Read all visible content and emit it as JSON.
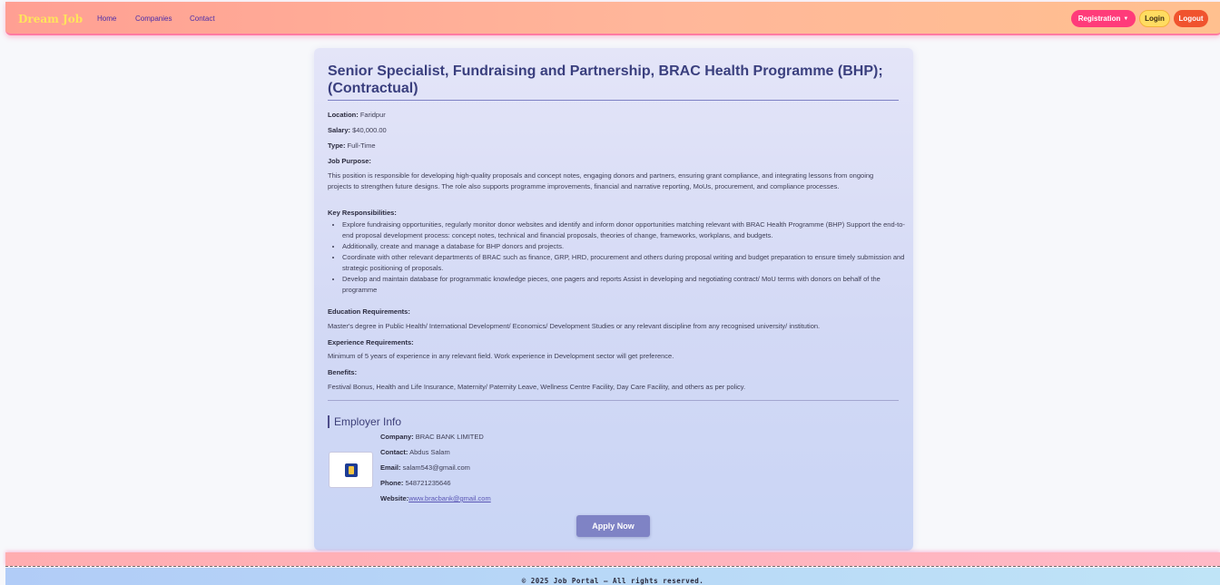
{
  "navbar": {
    "brand": "Dream Job",
    "links": [
      "Home",
      "Companies",
      "Contact"
    ],
    "registration_label": "Registration",
    "login_label": "Login",
    "logout_label": "Logout"
  },
  "job": {
    "title": "Senior Specialist, Fundraising and Partnership, BRAC Health Programme (BHP); (Contractual)",
    "location_label": "Location:",
    "location": "Faridpur",
    "salary_label": "Salary:",
    "salary": "$40,000.00",
    "type_label": "Type:",
    "type": "Full-Time",
    "purpose_label": "Job Purpose:",
    "purpose": "This position is responsible for developing high-quality proposals and concept notes, engaging donors and partners, ensuring grant compliance, and integrating lessons from ongoing projects to strengthen future designs. The role also supports programme improvements, financial and narrative reporting, MoUs, procurement, and compliance processes.",
    "responsibilities_label": "Key Responsibilities:",
    "responsibilities": [
      "Explore fundraising opportunities, regularly monitor donor websites and identify and inform donor opportunities matching relevant with BRAC Health Programme (BHP) Support the end-to-end proposal development process: concept notes, technical and financial proposals, theories of change, frameworks, workplans, and budgets.",
      "Additionally, create and manage a database for BHP donors and projects.",
      "Coordinate with other relevant departments of BRAC such as finance, GRP, HRD, procurement and others during proposal writing and budget preparation to ensure timely submission and strategic positioning of proposals.",
      "Develop and maintain database for programmatic knowledge pieces, one pagers and reports Assist in developing and negotiating contract/ MoU terms with donors on behalf of the programme"
    ],
    "education_label": "Education Requirements:",
    "education": "Master's degree in Public Health/ International Development/ Economics/ Development Studies or any relevant discipline from any recognised university/ institution.",
    "experience_label": "Experience Requirements:",
    "experience": "Minimum of 5 years of experience in any relevant field. Work experience in Development sector will get preference.",
    "benefits_label": "Benefits:",
    "benefits": "Festival Bonus, Health and Life Insurance, Maternity/ Paternity Leave, Wellness Centre Facility, Day Care Facility, and others as per policy."
  },
  "employer": {
    "heading": "Employer Info",
    "company_label": "Company:",
    "company": "BRAC BANK LIMITED",
    "contact_label": "Contact:",
    "contact": "Abdus Salam",
    "email_label": "Email:",
    "email": "salam543@gmail.com",
    "phone_label": "Phone:",
    "phone": "548721235646",
    "website_label": "Website:",
    "website": "www.bracbank@gmail.com",
    "logo_icon": "brac-bank-logo-icon"
  },
  "apply_label": "Apply Now",
  "footer": {
    "copyright": "© 2025 Job Portal — All rights reserved."
  }
}
